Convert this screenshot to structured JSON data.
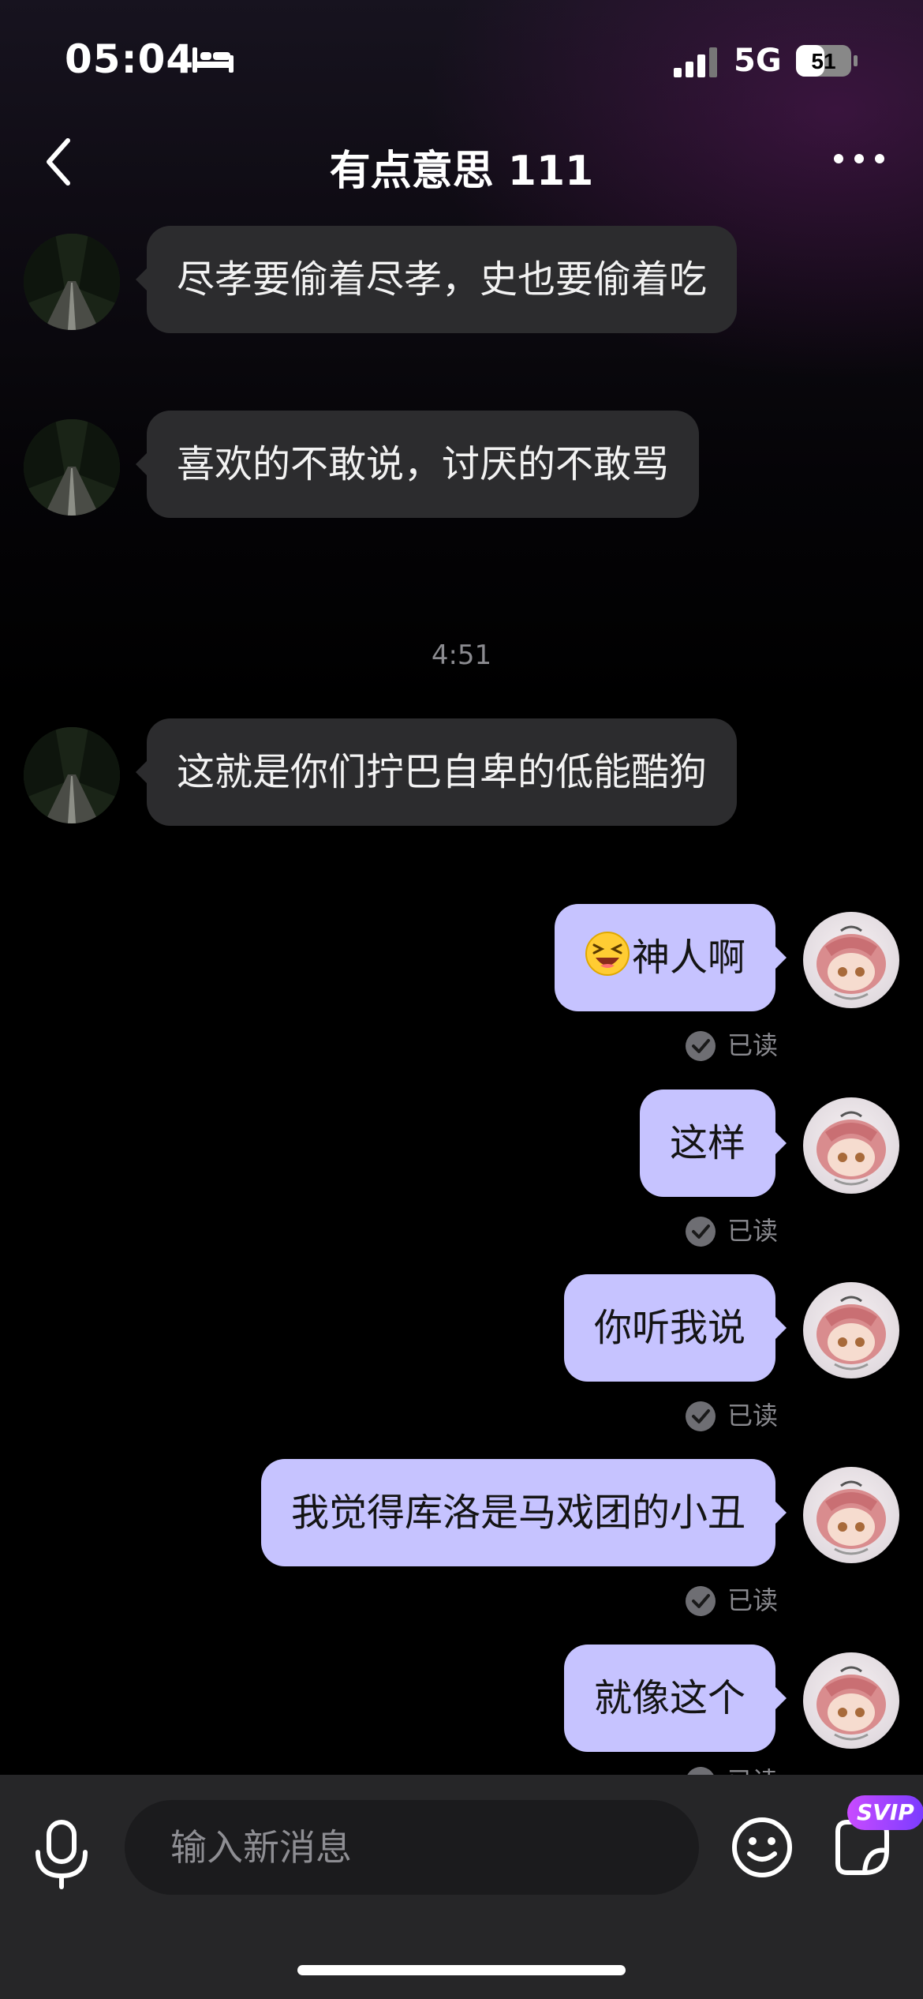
{
  "status_bar": {
    "time": "05:04",
    "network": "5G",
    "battery": "51"
  },
  "header": {
    "title": "有点意思 111"
  },
  "messages": [
    {
      "side": "in",
      "text": "尽孝要偷着尽孝，史也要偷着吃"
    },
    {
      "side": "in",
      "text": "喜欢的不敢说，讨厌的不敢骂"
    },
    {
      "side": "in",
      "text": "这就是你们拧巴自卑的低能酷狗"
    },
    {
      "side": "out",
      "text": "神人啊",
      "emoji": "laughing-emoji",
      "read": "已读"
    },
    {
      "side": "out",
      "text": "这样",
      "read": "已读"
    },
    {
      "side": "out",
      "text": "你听我说",
      "read": "已读"
    },
    {
      "side": "out",
      "text": "我觉得库洛是马戏团的小丑",
      "read": "已读"
    },
    {
      "side": "out",
      "text": "就像这个",
      "read": "已读"
    }
  ],
  "timestamp": "4:51",
  "input_bar": {
    "placeholder": "输入新消息",
    "svip_label": "SVIP"
  },
  "colors": {
    "outgoing_bubble": "#c6c3ff",
    "incoming_bubble": "#2c2c2e",
    "input_bar": "#262628"
  }
}
